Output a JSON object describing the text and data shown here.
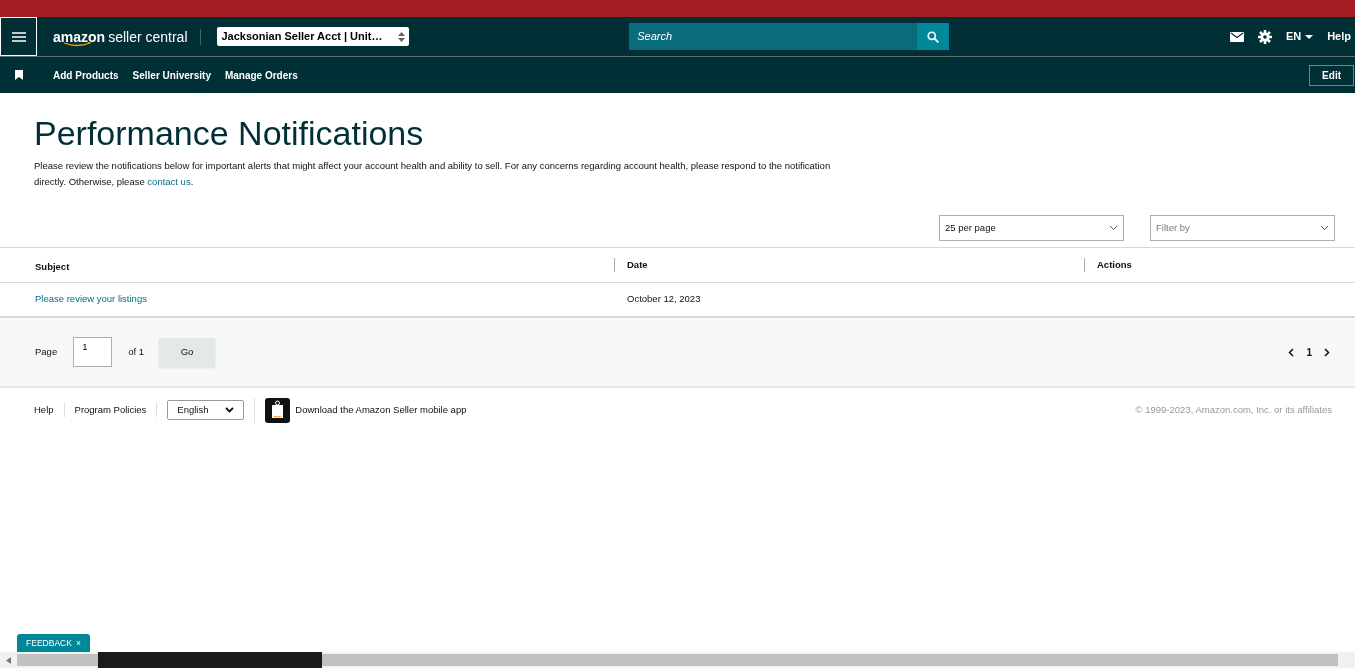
{
  "header": {
    "logo": {
      "brand": "amazon",
      "product": "seller central"
    },
    "account": "Jacksonian Seller Acct | Unit…",
    "search": {
      "placeholder": "Search"
    },
    "language": "EN",
    "help": "Help"
  },
  "nav": {
    "links": [
      "Add Products",
      "Seller University",
      "Manage Orders"
    ],
    "edit": "Edit"
  },
  "page": {
    "title": "Performance Notifications",
    "intro": "Please review the notifications below for important alerts that might affect your account health and ability to sell. For any concerns regarding account health, please respond to the notification directly. Otherwise, please",
    "intro_link": "contact us",
    "intro_end": "."
  },
  "controls": {
    "per_page": "25 per page",
    "filter": {
      "placeholder": "Filter by"
    }
  },
  "table": {
    "columns": [
      "Subject",
      "Date",
      "Actions"
    ],
    "rows": [
      {
        "subject": "Please review your listings",
        "date": "October 12, 2023"
      }
    ]
  },
  "pagination": {
    "label": "Page",
    "page": "1",
    "of": "of 1",
    "go": "Go",
    "current": "1"
  },
  "footer": {
    "links": [
      "Help",
      "Program Policies"
    ],
    "language": "English",
    "app": "Download the Amazon Seller mobile app",
    "copyright": "© 1999-2023, Amazon.com, Inc. or its affiliates"
  },
  "feedback": {
    "label": "FEEDBACK",
    "close": "×"
  }
}
